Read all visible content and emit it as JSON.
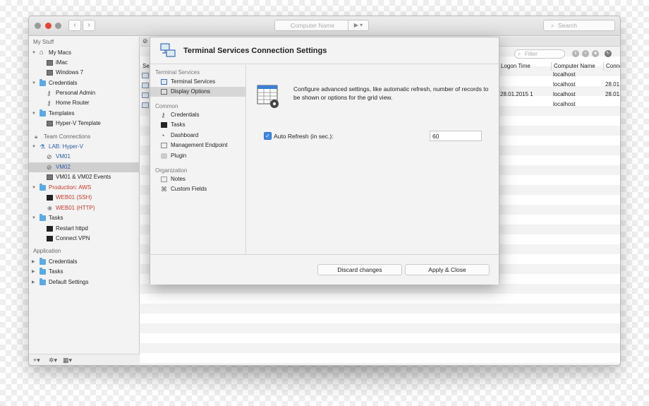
{
  "toolbar": {
    "back": "‹",
    "forward": "›",
    "computer_name_placeholder": "Computer Name",
    "play": "▶ ▾",
    "search_placeholder": "Search"
  },
  "sidebar": {
    "my_stuff": "My Stuff",
    "my_macs": "My Macs",
    "imac": "iMac",
    "windows7": "Windows 7",
    "credentials": "Credentials",
    "personal_admin": "Personal Admin",
    "home_router": "Home Router",
    "templates": "Templates",
    "hyperv_template": "Hyper-V Template",
    "team_connections": "Team Connections",
    "lab_hyperv": "LAB: Hyper-V",
    "vm01": "VM01",
    "vm02": "VM02",
    "vm_events": "VM01 & VM02 Events",
    "production_aws": "Production: AWS",
    "web01_ssh": "WEB01 (SSH)",
    "web01_http": "WEB01 (HTTP)",
    "tasks": "Tasks",
    "restart_httpd": "Restart httpd",
    "connect_vpn": "Connect VPN",
    "application": "Application",
    "app_credentials": "Credentials",
    "app_tasks": "Tasks",
    "default_settings": "Default Settings",
    "bottom_add": "+▾",
    "bottom_gear": "✲▾",
    "bottom_grid": "▦▾"
  },
  "content": {
    "filter_placeholder": "Filter",
    "columns": {
      "session": "Ses",
      "logon_time": "Logon Time",
      "computer_name": "Computer Name",
      "connection": "Conne"
    },
    "rows": [
      {
        "logon": "",
        "computer": "localhost",
        "conn": ""
      },
      {
        "logon": "",
        "computer": "localhost",
        "conn": "28.01."
      },
      {
        "logon": "28.01.2015 1",
        "computer": "localhost",
        "conn": "28.01."
      },
      {
        "logon": "",
        "computer": "localhost",
        "conn": ""
      }
    ]
  },
  "dialog": {
    "title": "Terminal Services Connection Settings",
    "nav": {
      "group_terminal": "Terminal Services",
      "terminal_services": "Terminal Services",
      "display_options": "Display Options",
      "group_common": "Common",
      "credentials": "Credentials",
      "tasks": "Tasks",
      "dashboard": "Dashboard",
      "management_endpoint": "Management Endpoint",
      "plugin": "Plugin",
      "group_organization": "Organization",
      "notes": "Notes",
      "custom_fields": "Custom Fields"
    },
    "description": "Configure advanced settings, like automatic refresh, number of records to be shown or options for the grid view.",
    "auto_refresh_label": "Auto Refresh (in sec.):",
    "auto_refresh_checked": true,
    "auto_refresh_value": "60",
    "discard_label": "Discard changes",
    "apply_label": "Apply & Close"
  },
  "colors": {
    "accent": "#3d8ae0",
    "folder": "#5aa9e3",
    "selected_row": "#cfcfcf",
    "red_text": "#c0392b",
    "blue_text": "#2a5ba8"
  }
}
